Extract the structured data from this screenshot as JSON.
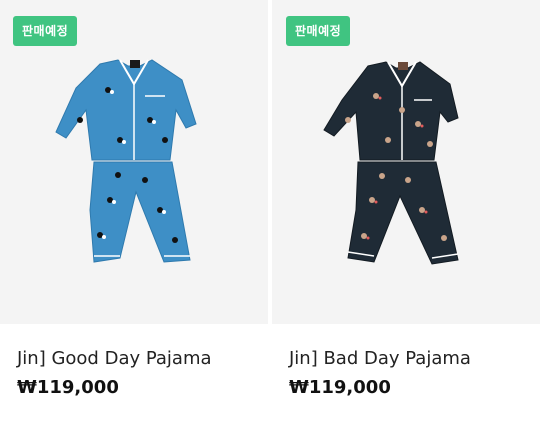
{
  "products": [
    {
      "badge": "판매예정",
      "name": "Jin] Good Day Pajama",
      "price": "₩119,000",
      "color": "#3e8fc6",
      "piping": "#ffffff"
    },
    {
      "badge": "판매예정",
      "name": "Jin] Bad Day Pajama",
      "price": "₩119,000",
      "color": "#1f2b36",
      "piping": "#ffffff"
    }
  ],
  "colors": {
    "badge_bg": "#40c481",
    "image_bg": "#f4f4f4"
  }
}
